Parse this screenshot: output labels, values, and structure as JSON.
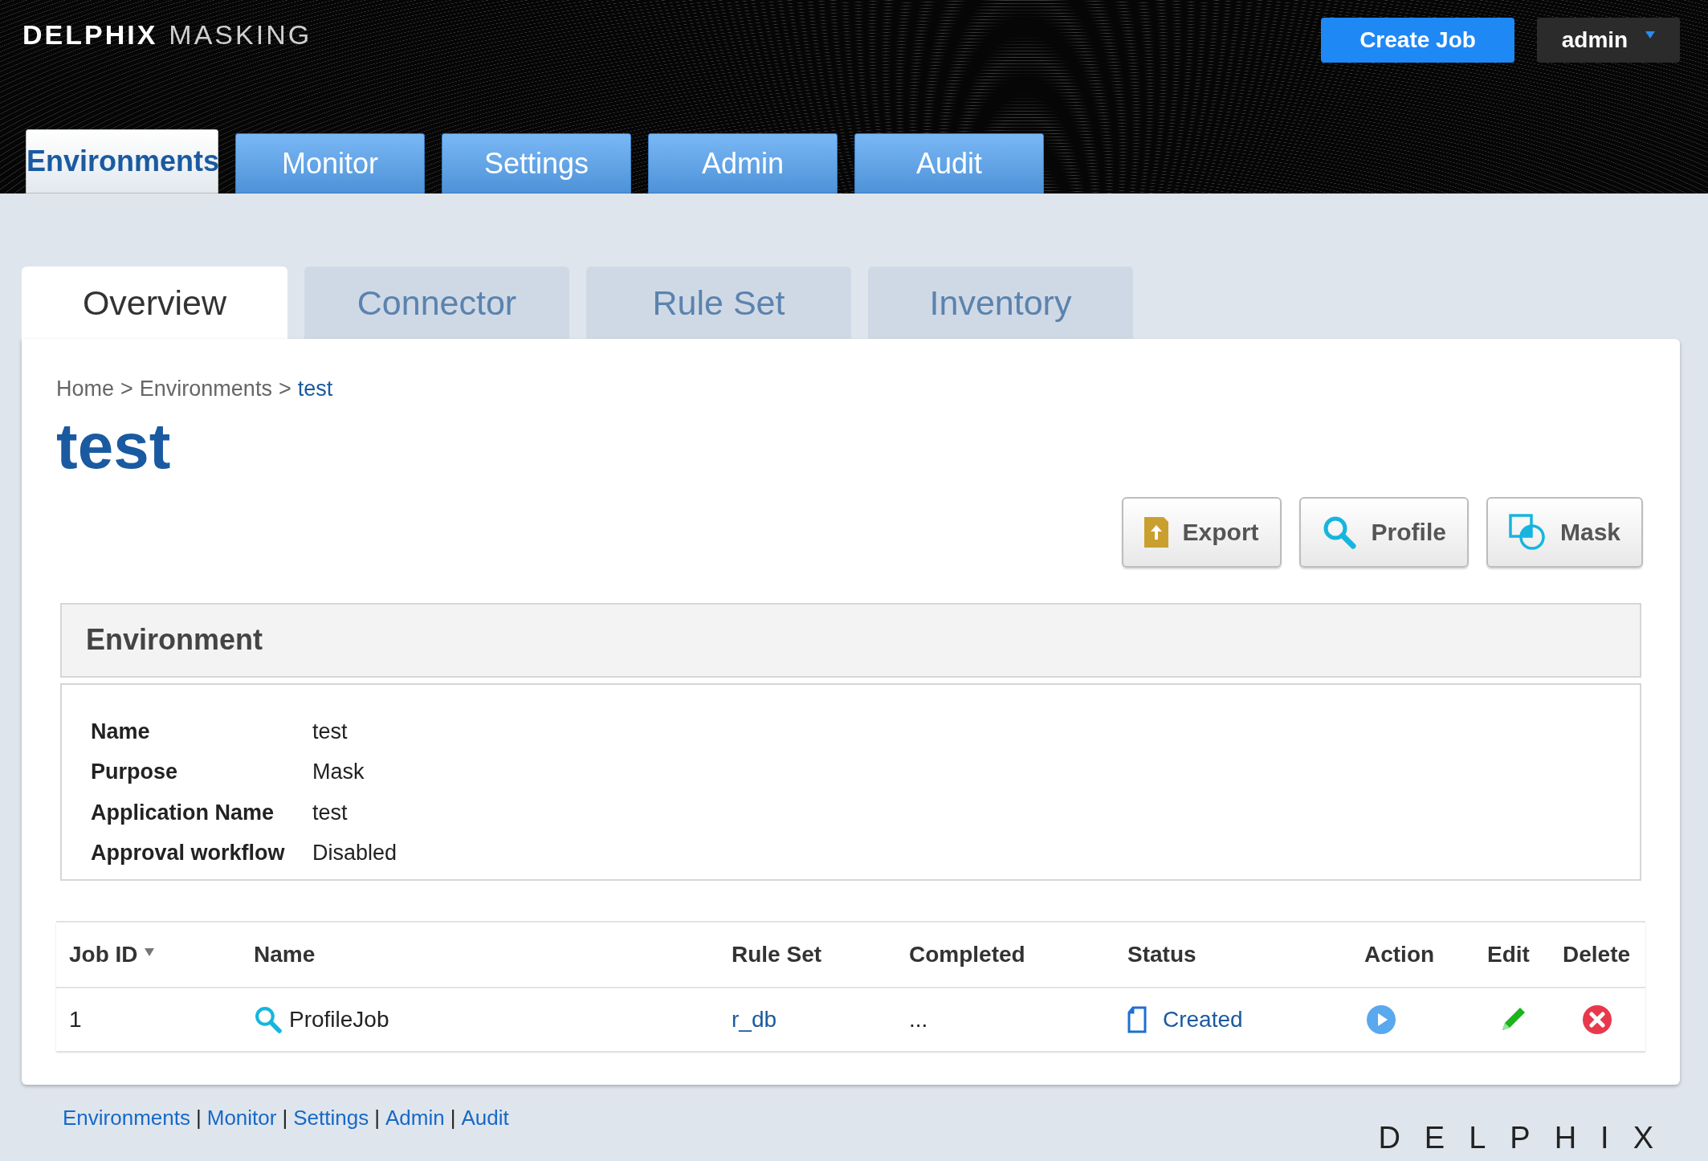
{
  "brand": {
    "name": "DELPHIX",
    "product": "MASKING"
  },
  "header": {
    "create_button": "Create Job",
    "user_menu": "admin"
  },
  "main_tabs": [
    {
      "label": "Environments",
      "selected": true
    },
    {
      "label": "Monitor",
      "selected": false
    },
    {
      "label": "Settings",
      "selected": false
    },
    {
      "label": "Admin",
      "selected": false
    },
    {
      "label": "Audit",
      "selected": false
    }
  ],
  "sub_tabs": [
    {
      "label": "Overview",
      "selected": true
    },
    {
      "label": "Connector",
      "selected": false
    },
    {
      "label": "Rule Set",
      "selected": false
    },
    {
      "label": "Inventory",
      "selected": false
    }
  ],
  "breadcrumb": [
    {
      "label": "Home",
      "current": false
    },
    {
      "label": "Environments",
      "current": false
    },
    {
      "label": "test",
      "current": true
    }
  ],
  "breadcrumb_separator": ">",
  "page_title": "test",
  "actions": [
    {
      "kind": "export",
      "label": "Export"
    },
    {
      "kind": "profile",
      "label": "Profile"
    },
    {
      "kind": "mask",
      "label": "Mask"
    }
  ],
  "environment": {
    "title": "Environment",
    "fields": [
      {
        "label": "Name",
        "value": "test"
      },
      {
        "label": "Purpose",
        "value": "Mask"
      },
      {
        "label": "Application Name",
        "value": "test"
      },
      {
        "label": "Approval workflow",
        "value": "Disabled"
      }
    ]
  },
  "jobs_table": {
    "columns": [
      {
        "label": "Job ID",
        "sorted": true
      },
      {
        "label": "Name",
        "sorted": false
      },
      {
        "label": "Rule Set",
        "sorted": false
      },
      {
        "label": "Completed",
        "sorted": false
      },
      {
        "label": "Status",
        "sorted": false
      },
      {
        "label": "Action",
        "sorted": false
      },
      {
        "label": "Edit",
        "sorted": false
      },
      {
        "label": "Delete",
        "sorted": false
      }
    ],
    "rows": [
      {
        "job_id": "1",
        "name": "ProfileJob",
        "kind": "profile",
        "rule_set": "r_db",
        "completed": "...",
        "status": "Created"
      }
    ]
  },
  "footer": {
    "links": [
      "Environments",
      "Monitor",
      "Settings",
      "Admin",
      "Audit"
    ],
    "separator": "|",
    "logo": "DELPHIX"
  }
}
